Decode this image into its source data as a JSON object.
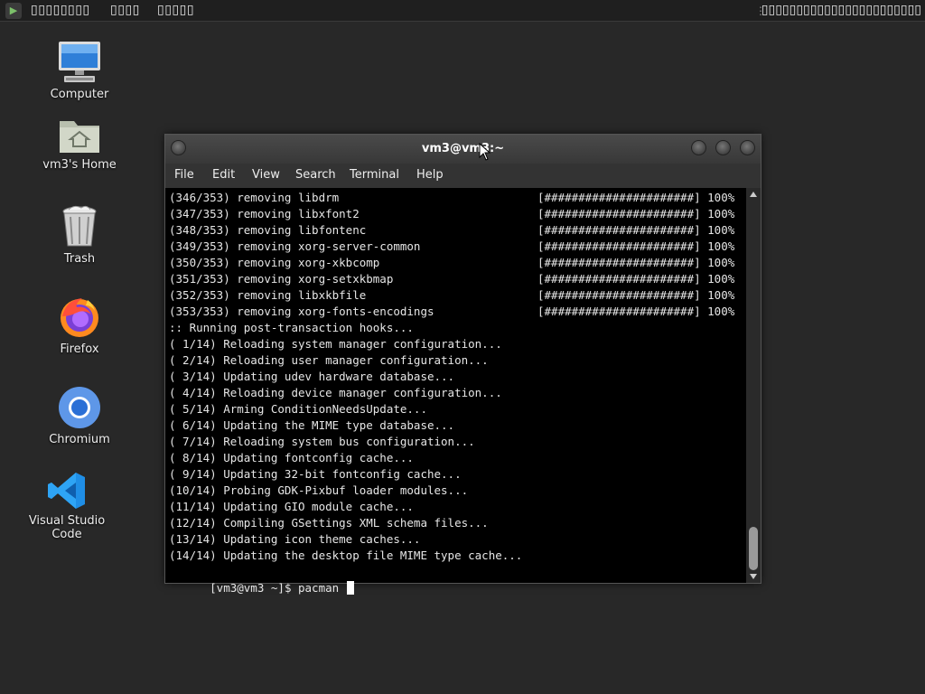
{
  "panel": {
    "launcher_icon": "terminal-launcher-icon",
    "menu1": "▯▯▯▯▯▯▯▯",
    "menu2": "▯▯▯▯",
    "menu3": "▯▯▯▯▯",
    "handle": "⋮",
    "clock": "▯▯▯▯▯▯▯▯▯▯▯▯▯▯▯▯▯▯▯▯▯▯▯"
  },
  "desktop": {
    "icons": [
      {
        "label": "Computer",
        "icon": "computer-icon"
      },
      {
        "label": "vm3's Home",
        "icon": "home-folder-icon"
      },
      {
        "label": "Trash",
        "icon": "trash-icon"
      },
      {
        "label": "Firefox",
        "icon": "firefox-icon"
      },
      {
        "label": "Chromium",
        "icon": "chromium-icon"
      },
      {
        "label": "Visual Studio Code",
        "icon": "vscode-icon"
      }
    ]
  },
  "terminal": {
    "title": "vm3@vm3:~",
    "menu": [
      "File",
      "Edit",
      "View",
      "Search",
      "Terminal",
      "Help"
    ],
    "lines": [
      "(346/353) removing libdrm",
      "(347/353) removing libxfont2",
      "(348/353) removing libfontenc",
      "(349/353) removing xorg-server-common",
      "(350/353) removing xorg-xkbcomp",
      "(351/353) removing xorg-setxkbmap",
      "(352/353) removing libxkbfile",
      "(353/353) removing xorg-fonts-encodings",
      ":: Running post-transaction hooks...",
      "( 1/14) Reloading system manager configuration...",
      "( 2/14) Reloading user manager configuration...",
      "( 3/14) Updating udev hardware database...",
      "( 4/14) Reloading device manager configuration...",
      "( 5/14) Arming ConditionNeedsUpdate...",
      "( 6/14) Updating the MIME type database...",
      "( 7/14) Reloading system bus configuration...",
      "( 8/14) Updating fontconfig cache...",
      "( 9/14) Updating 32-bit fontconfig cache...",
      "(10/14) Probing GDK-Pixbuf loader modules...",
      "(11/14) Updating GIO module cache...",
      "(12/14) Compiling GSettings XML schema files...",
      "(13/14) Updating icon theme caches...",
      "(14/14) Updating the desktop file MIME type cache..."
    ],
    "progress_bar": "[######################] 100%",
    "prompt": "[vm3@vm3 ~]$ pacman ",
    "scroll_position": 1.0
  }
}
